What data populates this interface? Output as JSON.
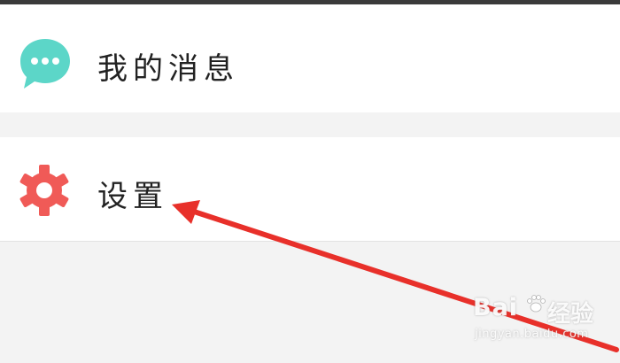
{
  "menu": {
    "items": [
      {
        "label": "我的消息",
        "icon": "chat-bubble-icon",
        "icon_color": "#5cd6c8"
      },
      {
        "label": "设置",
        "icon": "gear-icon",
        "icon_color": "#f05a57"
      }
    ]
  },
  "annotation": {
    "arrow_color": "#e8302a",
    "target": "settings"
  },
  "watermark": {
    "logo": "Bai",
    "brand": "经验",
    "url": "jingyan.baidu.com"
  }
}
